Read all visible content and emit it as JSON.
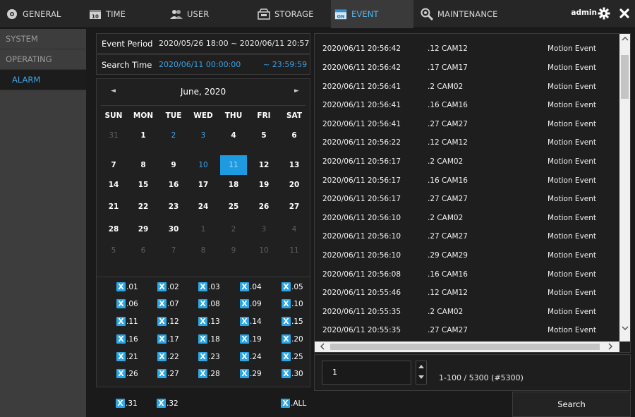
{
  "nav": {
    "tabs": [
      {
        "label": "GENERAL",
        "icon": "general-icon"
      },
      {
        "label": "TIME",
        "icon": "time-icon"
      },
      {
        "label": "USER",
        "icon": "user-icon"
      },
      {
        "label": "STORAGE",
        "icon": "storage-icon"
      },
      {
        "label": "EVENT",
        "icon": "event-icon"
      },
      {
        "label": "MAINTENANCE",
        "icon": "maintenance-icon"
      }
    ],
    "active_tab": "EVENT",
    "user": "admin",
    "accent_color": "#3ea6e8"
  },
  "sidebar": {
    "items": [
      {
        "label": "SYSTEM"
      },
      {
        "label": "OPERATING"
      },
      {
        "label": "ALARM"
      }
    ],
    "active_item": "ALARM"
  },
  "period": {
    "event_period_label": "Event Period",
    "event_period_value": "2020/05/26 18:00 ~ 2020/06/11 20:57",
    "search_time_label": "Search Time",
    "search_time_start": "2020/06/11 00:00:00",
    "search_time_end": "~ 23:59:59"
  },
  "calendar": {
    "month_label": "June, 2020",
    "prev_arrow": "◄",
    "next_arrow": "►",
    "weekdays": [
      "SUN",
      "MON",
      "TUE",
      "WED",
      "THU",
      "FRI",
      "SAT"
    ],
    "weeks": [
      [
        {
          "d": "31",
          "s": "dim"
        },
        {
          "d": "1",
          "s": "cur"
        },
        {
          "d": "2",
          "s": "ev"
        },
        {
          "d": "3",
          "s": "ev"
        },
        {
          "d": "4",
          "s": "cur"
        },
        {
          "d": "5",
          "s": "cur"
        },
        {
          "d": "6",
          "s": "cur"
        }
      ],
      [
        {
          "d": "7",
          "s": "cur"
        },
        {
          "d": "8",
          "s": "cur"
        },
        {
          "d": "9",
          "s": "cur"
        },
        {
          "d": "10",
          "s": "ev"
        },
        {
          "d": "11",
          "s": "sel"
        },
        {
          "d": "12",
          "s": "cur"
        },
        {
          "d": "13",
          "s": "cur"
        }
      ],
      [
        {
          "d": "14",
          "s": "cur"
        },
        {
          "d": "15",
          "s": "cur"
        },
        {
          "d": "16",
          "s": "cur"
        },
        {
          "d": "17",
          "s": "cur"
        },
        {
          "d": "18",
          "s": "cur"
        },
        {
          "d": "19",
          "s": "cur"
        },
        {
          "d": "20",
          "s": "cur"
        }
      ],
      [
        {
          "d": "21",
          "s": "cur"
        },
        {
          "d": "22",
          "s": "cur"
        },
        {
          "d": "23",
          "s": "cur"
        },
        {
          "d": "24",
          "s": "cur"
        },
        {
          "d": "25",
          "s": "cur"
        },
        {
          "d": "26",
          "s": "cur"
        },
        {
          "d": "27",
          "s": "cur"
        }
      ],
      [
        {
          "d": "28",
          "s": "cur"
        },
        {
          "d": "29",
          "s": "cur"
        },
        {
          "d": "30",
          "s": "cur"
        },
        {
          "d": "1",
          "s": "dim"
        },
        {
          "d": "2",
          "s": "dim"
        },
        {
          "d": "3",
          "s": "dim"
        },
        {
          "d": "4",
          "s": "dim"
        }
      ],
      [
        {
          "d": "5",
          "s": "dim"
        },
        {
          "d": "6",
          "s": "dim"
        },
        {
          "d": "7",
          "s": "dim"
        },
        {
          "d": "8",
          "s": "dim"
        },
        {
          "d": "9",
          "s": "dim"
        },
        {
          "d": "10",
          "s": "dim"
        },
        {
          "d": "11",
          "s": "dim"
        }
      ]
    ],
    "selected_day": "11"
  },
  "cameras": {
    "check_mark": "X",
    "items": [
      ".01",
      ".02",
      ".03",
      ".04",
      ".05",
      ".06",
      ".07",
      ".08",
      ".09",
      ".10",
      ".11",
      ".12",
      ".13",
      ".14",
      ".15",
      ".16",
      ".17",
      ".18",
      ".19",
      ".20",
      ".21",
      ".22",
      ".23",
      ".24",
      ".25",
      ".26",
      ".27",
      ".28",
      ".29",
      ".30"
    ],
    "extra": [
      ".31",
      ".32"
    ],
    "all_label": ".ALL"
  },
  "events": [
    {
      "time": "2020/06/11 20:56:42",
      "cam": ".12 CAM12",
      "type": "Motion Event"
    },
    {
      "time": "2020/06/11 20:56:42",
      "cam": ".17 CAM17",
      "type": "Motion Event"
    },
    {
      "time": "2020/06/11 20:56:41",
      "cam": ".2 CAM02",
      "type": "Motion Event"
    },
    {
      "time": "2020/06/11 20:56:41",
      "cam": ".16 CAM16",
      "type": "Motion Event"
    },
    {
      "time": "2020/06/11 20:56:41",
      "cam": ".27 CAM27",
      "type": "Motion Event"
    },
    {
      "time": "2020/06/11 20:56:22",
      "cam": ".12 CAM12",
      "type": "Motion Event"
    },
    {
      "time": "2020/06/11 20:56:17",
      "cam": ".2 CAM02",
      "type": "Motion Event"
    },
    {
      "time": "2020/06/11 20:56:17",
      "cam": ".16 CAM16",
      "type": "Motion Event"
    },
    {
      "time": "2020/06/11 20:56:17",
      "cam": ".27 CAM27",
      "type": "Motion Event"
    },
    {
      "time": "2020/06/11 20:56:10",
      "cam": ".2 CAM02",
      "type": "Motion Event"
    },
    {
      "time": "2020/06/11 20:56:10",
      "cam": ".27 CAM27",
      "type": "Motion Event"
    },
    {
      "time": "2020/06/11 20:56:10",
      "cam": ".29 CAM29",
      "type": "Motion Event"
    },
    {
      "time": "2020/06/11 20:56:08",
      "cam": ".16 CAM16",
      "type": "Motion Event"
    },
    {
      "time": "2020/06/11 20:55:46",
      "cam": ".12 CAM12",
      "type": "Motion Event"
    },
    {
      "time": "2020/06/11 20:55:35",
      "cam": ".2 CAM02",
      "type": "Motion Event"
    },
    {
      "time": "2020/06/11 20:55:35",
      "cam": ".27 CAM27",
      "type": "Motion Event"
    }
  ],
  "pager": {
    "page_value": "1",
    "count_text": "1-100 / 5300 (#5300)"
  },
  "search_label": "Search"
}
